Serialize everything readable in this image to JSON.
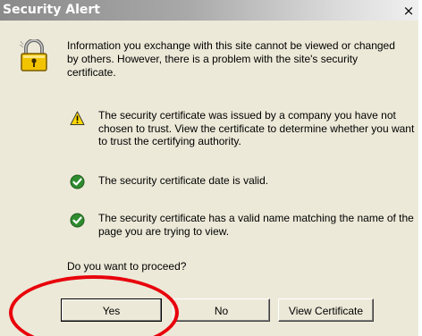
{
  "window": {
    "title": "Security Alert",
    "close_glyph": "×"
  },
  "intro": "Information you exchange with this site cannot be viewed or changed by others. However, there is a problem with the site's security certificate.",
  "items": [
    {
      "icon": "warning-icon",
      "text": "The security certificate was issued by a company you have not chosen to trust. View the certificate to determine whether you want to trust the certifying authority."
    },
    {
      "icon": "check-icon",
      "text": "The security certificate date is valid."
    },
    {
      "icon": "check-icon",
      "text": "The security certificate has a valid name matching the name of the page you are trying to view."
    }
  ],
  "question": "Do you want to proceed?",
  "buttons": {
    "yes": "Yes",
    "no": "No",
    "view_certificate": "View Certificate"
  },
  "colors": {
    "dialog_bg": "#ece9d8",
    "highlight": "#e8000b",
    "check_green": "#2e8b2e",
    "warning_yellow": "#ffd800"
  }
}
